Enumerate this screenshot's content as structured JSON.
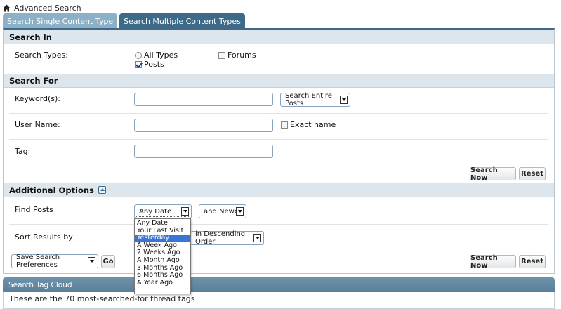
{
  "breadcrumb": {
    "title": "Advanced Search",
    "icon": "home-icon"
  },
  "tabs": [
    {
      "label": "Search Single Content Type",
      "active": false
    },
    {
      "label": "Search Multiple Content Types",
      "active": true
    }
  ],
  "search_in": {
    "heading": "Search In",
    "types_label": "Search Types:",
    "options": [
      {
        "label": "All Types",
        "control": "radio",
        "checked": false
      },
      {
        "label": "Posts",
        "control": "checkbox",
        "checked": true
      },
      {
        "label": "Forums",
        "control": "checkbox",
        "checked": false
      }
    ]
  },
  "search_for": {
    "heading": "Search For",
    "keyword_label": "Keyword(s):",
    "keyword_value": "",
    "keyword_scope": "Search Entire Posts",
    "username_label": "User Name:",
    "username_value": "",
    "exact_name_label": "Exact name",
    "exact_name_checked": false,
    "tag_label": "Tag:",
    "tag_value": "",
    "search_button": "Search Now",
    "reset_button": "Reset"
  },
  "additional": {
    "heading": "Additional Options",
    "toggle_icon": "collapse-icon",
    "find_posts_label": "Find Posts",
    "date_value": "Any Date",
    "date_direction": "and Newer",
    "sort_label": "Sort Results by",
    "sort_order": "in Descending Order",
    "save_prefs": "Save Search Preferences",
    "go_button": "Go",
    "search_button": "Search Now",
    "reset_button": "Reset"
  },
  "date_dropdown": {
    "items": [
      "Any Date",
      "Your Last Visit",
      "Yesterday",
      "A Week Ago",
      "2 Weeks Ago",
      "A Month Ago",
      "3 Months Ago",
      "6 Months Ago",
      "A Year Ago"
    ],
    "highlighted_index": 2
  },
  "tag_cloud": {
    "heading": "Search Tag Cloud",
    "description": "These are the 70 most-searched-for thread tags"
  },
  "colors": {
    "tab_active": "#3d6a88",
    "tab_inactive": "#8cb0c6",
    "section_bg": "#dde6ec",
    "highlight": "#3875d7"
  }
}
